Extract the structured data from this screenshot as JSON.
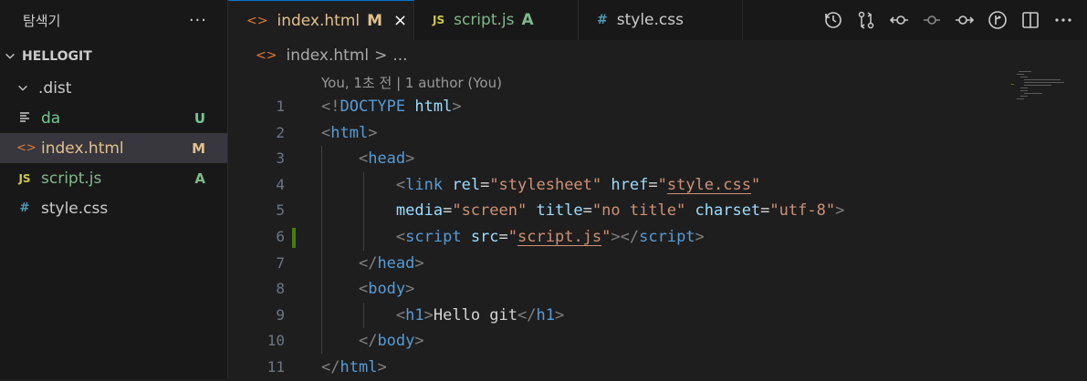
{
  "sidebar": {
    "title": "탐색기",
    "more": "···",
    "section": "HELLOGIT",
    "items": [
      {
        "label": ".dist",
        "status": "",
        "icon": "chevron-down-icon"
      },
      {
        "label": "da",
        "status": "U",
        "icon": "text-file-icon"
      },
      {
        "label": "index.html",
        "status": "M",
        "icon": "html-file-icon"
      },
      {
        "label": "script.js",
        "status": "A",
        "icon": "js-file-icon"
      },
      {
        "label": "style.css",
        "status": "",
        "icon": "css-file-icon"
      }
    ]
  },
  "tabs": [
    {
      "label": "index.html",
      "status": "M",
      "close": "×",
      "icon": "<>"
    },
    {
      "label": "script.js",
      "status": "A",
      "icon": "JS"
    },
    {
      "label": "style.css",
      "status": "",
      "icon": "#"
    }
  ],
  "breadcrumb": {
    "file": "index.html",
    "sep": ">",
    "rest": "..."
  },
  "codelens": "You, 1초 전 | 1 author (You)",
  "line_numbers": [
    "1",
    "2",
    "3",
    "4",
    "5",
    "6",
    "7",
    "8",
    "9",
    "10",
    "11"
  ],
  "code": {
    "l1": {
      "open": "<!",
      "doctype": "DOCTYPE",
      "html": "html",
      "close": ">"
    },
    "l2": {
      "open": "<",
      "tag": "html",
      "close": ">"
    },
    "l3": {
      "open": "<",
      "tag": "head",
      "close": ">"
    },
    "l4": {
      "open": "<",
      "tag": "link",
      "a1": "rel",
      "v1": "\"stylesheet\"",
      "a2": "href",
      "v2q": "\"",
      "v2": "style.css",
      "v2e": "\""
    },
    "l5": {
      "a1": "media",
      "v1": "\"screen\"",
      "a2": "title",
      "v2": "\"no title\"",
      "a3": "charset",
      "v3": "\"utf-8\"",
      "close": ">"
    },
    "l6": {
      "open": "<",
      "tag": "script",
      "a1": "src",
      "v1q": "\"",
      "v1": "script.js",
      "v1e": "\"",
      "close": "></",
      "tag2": "script",
      "close2": ">"
    },
    "l7": {
      "open": "</",
      "tag": "head",
      "close": ">"
    },
    "l8": {
      "open": "<",
      "tag": "body",
      "close": ">"
    },
    "l9": {
      "open": "<",
      "tag": "h1",
      "mid": ">",
      "text": "Hello git",
      "open2": "</",
      "tag2": "h1",
      "close": ">"
    },
    "l10": {
      "open": "</",
      "tag": "body",
      "close": ">"
    },
    "l11": {
      "open": "</",
      "tag": "html",
      "close": ">"
    }
  },
  "toolbar": [
    "history-icon",
    "compare-changes-icon",
    "previous-change-icon",
    "commit-icon",
    "next-change-icon",
    "git-graph-icon",
    "split-editor-icon",
    "more-actions-icon"
  ]
}
